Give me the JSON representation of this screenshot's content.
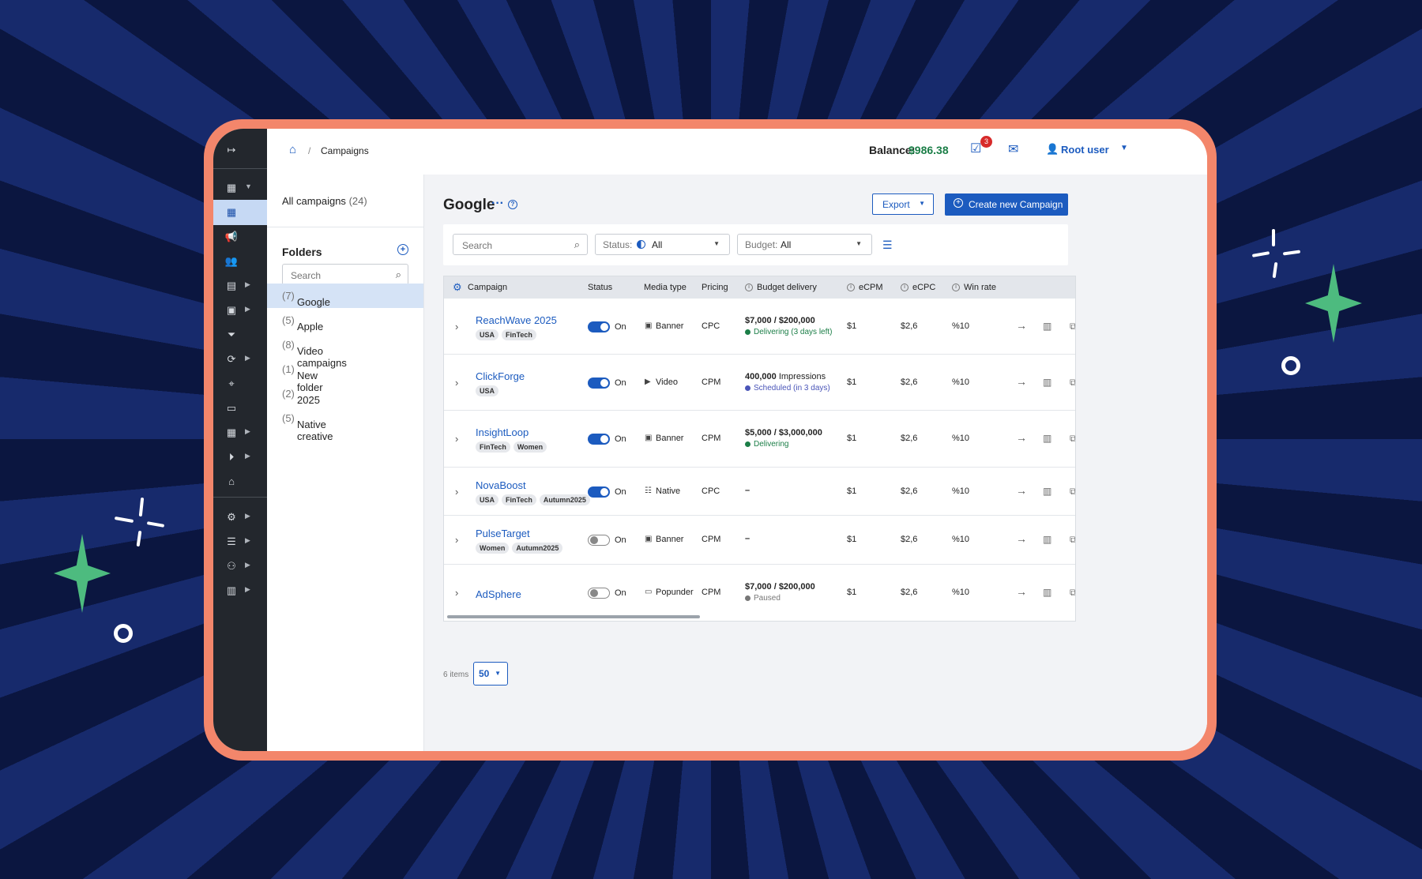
{
  "breadcrumb": {
    "current": "Campaigns"
  },
  "topbar": {
    "balance_label": "Balance:",
    "balance_value": "$986.38",
    "notification_count": "3",
    "user_name": "Root user"
  },
  "folders_panel": {
    "all_campaigns_label": "All campaigns",
    "all_campaigns_count": "(24)",
    "title": "Folders",
    "search_placeholder": "Search",
    "items": [
      {
        "label": "Google",
        "count": "(7)"
      },
      {
        "label": "Apple",
        "count": "(5)"
      },
      {
        "label": "Video campaigns",
        "count": "(8)"
      },
      {
        "label": "New folder",
        "count": "(1)"
      },
      {
        "label": "2025",
        "count": "(2)"
      },
      {
        "label": "Native creative",
        "count": "(5)"
      }
    ]
  },
  "main": {
    "title": "Google",
    "export_label": "Export",
    "create_label": "Create new Campaign",
    "filters": {
      "search_placeholder": "Search",
      "status_label": "Status:",
      "status_value": "All",
      "budget_label": "Budget:",
      "budget_value": "All"
    },
    "columns": [
      "Campaign",
      "Status",
      "Media type",
      "Pricing",
      "Budget delivery",
      "eCPM",
      "eCPC",
      "Win rate"
    ],
    "rows": [
      {
        "name": "ReachWave 2025",
        "tags": [
          "USA",
          "FinTech"
        ],
        "status": "On",
        "toggle_on": true,
        "media": "Banner",
        "media_icon": "image-icon",
        "pricing": "CPC",
        "budget_strong": "$7,000 / $200,000",
        "budget_rest": "",
        "budget_status": "Delivering (3 days left)",
        "status_color": "#1b7e47",
        "ecpm": "$1",
        "ecpc": "$2,6",
        "win_rate": "%10"
      },
      {
        "name": "ClickForge",
        "tags": [
          "USA"
        ],
        "status": "On",
        "toggle_on": true,
        "media": "Video",
        "media_icon": "video-icon",
        "pricing": "CPM",
        "budget_strong": "400,000",
        "budget_rest": " Impressions",
        "budget_status": "Scheduled (in 3 days)",
        "status_color": "#4a55b8",
        "ecpm": "$1",
        "ecpc": "$2,6",
        "win_rate": "%10"
      },
      {
        "name": "InsightLoop",
        "tags": [
          "FinTech",
          "Women"
        ],
        "status": "On",
        "toggle_on": true,
        "media": "Banner",
        "media_icon": "image-icon",
        "pricing": "CPM",
        "budget_strong": "$5,000 / $3,000,000",
        "budget_rest": "",
        "budget_status": "Delivering",
        "status_color": "#1b7e47",
        "ecpm": "$1",
        "ecpc": "$2,6",
        "win_rate": "%10"
      },
      {
        "name": "NovaBoost",
        "tags": [
          "USA",
          "FinTech",
          "Autumn2025"
        ],
        "status": "On",
        "toggle_on": true,
        "media": "Native",
        "media_icon": "native-icon",
        "pricing": "CPC",
        "budget_strong": "–",
        "budget_rest": "",
        "budget_status": "",
        "status_color": "",
        "ecpm": "$1",
        "ecpc": "$2,6",
        "win_rate": "%10"
      },
      {
        "name": "PulseTarget",
        "tags": [
          "Women",
          "Autumn2025"
        ],
        "status": "On",
        "toggle_on": false,
        "media": "Banner",
        "media_icon": "image-icon",
        "pricing": "CPM",
        "budget_strong": "–",
        "budget_rest": "",
        "budget_status": "",
        "status_color": "",
        "ecpm": "$1",
        "ecpc": "$2,6",
        "win_rate": "%10"
      },
      {
        "name": "AdSphere",
        "tags": [],
        "status": "On",
        "toggle_on": false,
        "media": "Popunder",
        "media_icon": "popunder-icon",
        "pricing": "CPM",
        "budget_strong": "$7,000 / $200,000",
        "budget_rest": "",
        "budget_status": "Paused",
        "status_color": "#777777",
        "ecpm": "$1",
        "ecpc": "$2,6",
        "win_rate": "%10"
      }
    ],
    "items_count_label": "6 items",
    "page_size": "50"
  },
  "colors": {
    "accent": "#1c5bbf",
    "frame": "#f3866b",
    "success": "#1b7e47",
    "rail": "#23272d"
  }
}
